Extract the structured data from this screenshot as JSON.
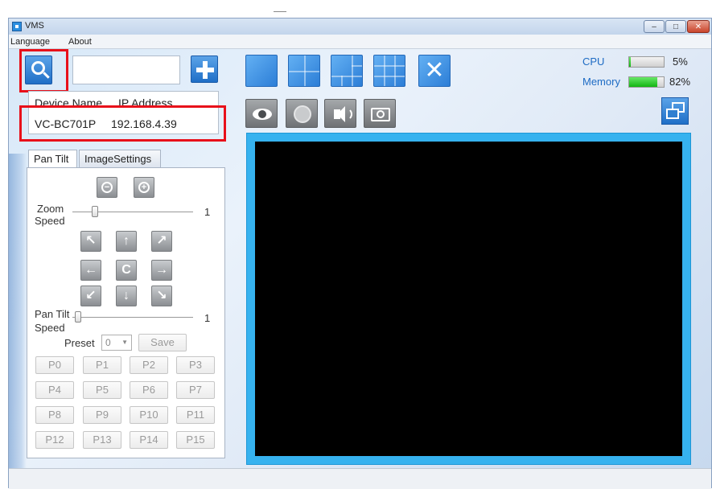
{
  "window": {
    "title": "VMS"
  },
  "menu": {
    "items": [
      "Language",
      "About"
    ]
  },
  "search": {
    "value": "",
    "icon": "search-icon"
  },
  "device_table": {
    "headers": [
      "Device Name",
      "IP Address"
    ],
    "rows": [
      [
        "VC-BC701P",
        "192.168.4.39"
      ]
    ]
  },
  "monitor": {
    "cpu_label": "CPU",
    "cpu_value": "5%",
    "cpu_fraction": 0.05,
    "memory_label": "Memory",
    "memory_value": "82%",
    "memory_fraction": 0.82
  },
  "tabs": [
    "Pan Tilt",
    "ImageSettings"
  ],
  "ptz": {
    "zoom_label_1": "Zoom",
    "zoom_label_2": "Speed",
    "zoom_value": "1",
    "pan_label_1": "Pan Tilt",
    "pan_label_2": "Speed",
    "pan_value": "1",
    "center_glyph": "C",
    "preset_label": "Preset",
    "preset_value": "0",
    "save_label": "Save",
    "presets": [
      "P0",
      "P1",
      "P2",
      "P3",
      "P4",
      "P5",
      "P6",
      "P7",
      "P8",
      "P9",
      "P10",
      "P11",
      "P12",
      "P13",
      "P14",
      "P15"
    ]
  },
  "colors": {
    "accent": "#2c7ed7",
    "highlight": "#e8101a",
    "video_border": "#36b2ef",
    "memory_bar": "#12b512"
  }
}
